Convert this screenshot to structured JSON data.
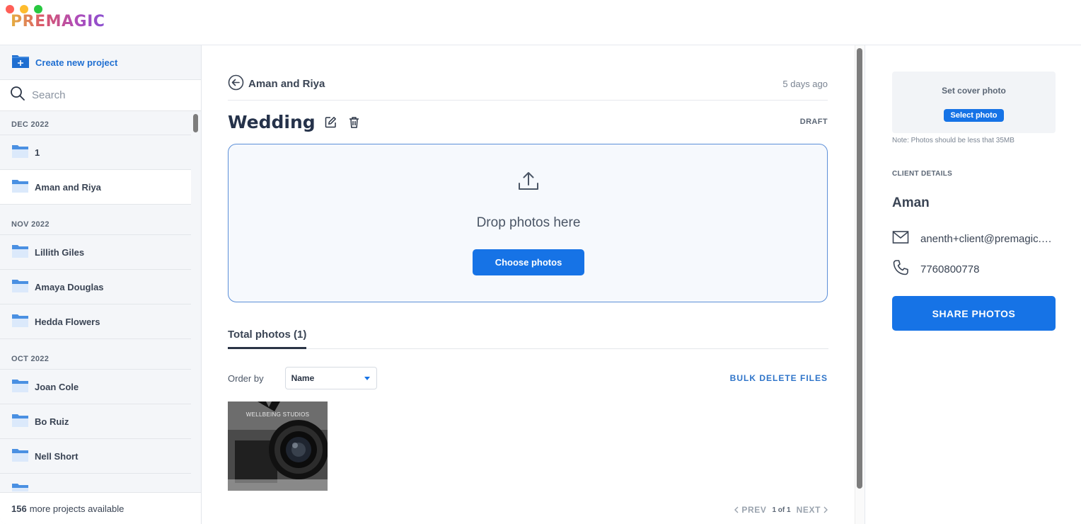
{
  "app": {
    "logo": "PREMAGIC"
  },
  "sidebar": {
    "create_label": "Create new project",
    "search_placeholder": "Search",
    "groups": [
      {
        "label": "DEC 2022",
        "items": [
          "1",
          "Aman and Riya"
        ]
      },
      {
        "label": "NOV 2022",
        "items": [
          "Lillith Giles",
          "Amaya Douglas",
          "Hedda Flowers"
        ]
      },
      {
        "label": "OCT 2022",
        "items": [
          "Joan Cole",
          "Bo Ruiz",
          "Nell Short"
        ]
      }
    ],
    "active_item": "Aman and Riya",
    "more_count": "156",
    "more_text": "more projects available"
  },
  "main": {
    "back_label": "Aman and Riya",
    "time_ago": "5 days ago",
    "title": "Wedding",
    "status": "DRAFT",
    "dropzone_text": "Drop photos here",
    "choose_label": "Choose photos",
    "tab_label": "Total photos (1)",
    "order_label": "Order by",
    "order_value": "Name",
    "bulk_delete_label": "BULK DELETE FILES",
    "photo_caption": "WELLBEING STUDIOS",
    "pager": {
      "prev": "PREV",
      "page": "1 of 1",
      "next": "NEXT"
    }
  },
  "right": {
    "cover_title": "Set cover photo",
    "select_photo_label": "Select photo",
    "cover_note": "Note: Photos should be less that 35MB",
    "client_details_label": "CLIENT DETAILS",
    "client_name": "Aman",
    "email": "anenth+client@premagic.com",
    "phone": "7760800778",
    "share_label": "SHARE PHOTOS"
  },
  "colors": {
    "accent": "#1673e6",
    "link": "#1f6fd1",
    "folder": "#4a90e2"
  }
}
